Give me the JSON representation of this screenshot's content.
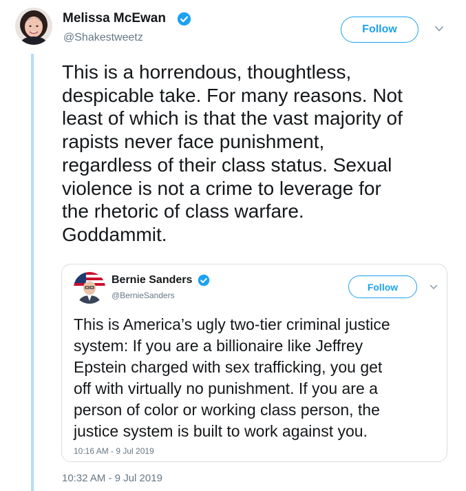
{
  "tweet": {
    "author_name": "Melissa McEwan",
    "author_handle": "@Shakestweetz",
    "follow_label": "Follow",
    "text": "This is a horrendous, thoughtless,\ndespicable take. For many reasons. Not\nleast of which is that the vast majority of\nrapists never face punishment,\nregardless of their class status. Sexual\nviolence is not a crime to leverage for\nthe rhetoric of class warfare.\nGoddammit.",
    "timestamp": "10:32 AM - 9 Jul 2019"
  },
  "quoted_tweet": {
    "author_name": "Bernie Sanders",
    "author_handle": "@BernieSanders",
    "follow_label": "Follow",
    "text": "This is America’s ugly two-tier criminal justice\nsystem: If you are a billionaire like Jeffrey\nEpstein charged with sex trafficking, you get\noff with virtually no punishment. If you are a\nperson of color or working class person, the\njustice system is built to work against you.",
    "timestamp": "10:16 AM - 9 Jul 2019"
  },
  "colors": {
    "accent": "#1da1f2",
    "thread_line": "#b5dcf7",
    "secondary_text": "#657786",
    "primary_text": "#14171a",
    "card_border": "#d8dee3"
  },
  "icons": {
    "verified": "verified-badge-icon",
    "menu": "chevron-down-icon"
  }
}
